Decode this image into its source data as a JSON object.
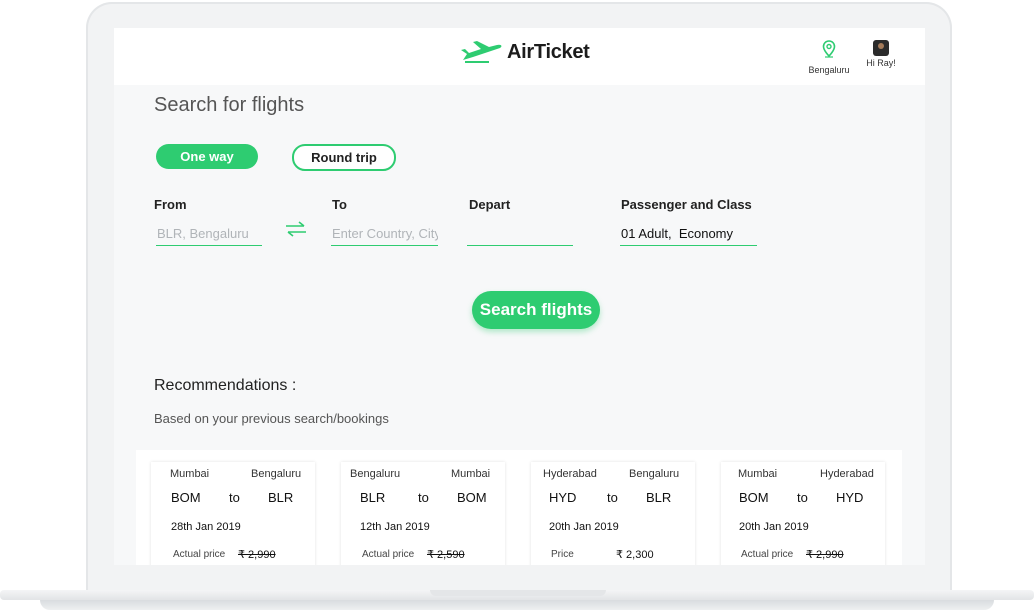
{
  "brand": {
    "name": "AirTicket",
    "accent_color": "#2ecc71",
    "logo_icon": "airplane-icon"
  },
  "nav": {
    "location_label": "Bengaluru",
    "location_icon": "location-pin-icon",
    "user_label": "Hi Ray!"
  },
  "search": {
    "title": "Search for flights",
    "trip_types": [
      "One way",
      "Round trip"
    ],
    "selected_trip": "One way",
    "from_label": "From",
    "from_placeholder": "BLR, Bengaluru",
    "to_label": "To",
    "to_placeholder": "Enter Country, City",
    "depart_label": "Depart",
    "depart_value": "",
    "passenger_label": "Passenger and Class",
    "passenger_value": "01 Adult,  Economy",
    "submit_label": "Search flights"
  },
  "recommendations": {
    "title": "Recommendations :",
    "subtitle": "Based on your previous search/bookings",
    "cards": [
      {
        "from_city": "Mumbai",
        "to_city": "Bengaluru",
        "from_code": "BOM",
        "sep": "to",
        "to_code": "BLR",
        "date": "28th Jan 2019",
        "price_label": "Actual price",
        "price": "₹ 2,990",
        "struck": true
      },
      {
        "from_city": "Bengaluru",
        "to_city": "Mumbai",
        "from_code": "BLR",
        "sep": "to",
        "to_code": "BOM",
        "date": "12th Jan 2019",
        "price_label": "Actual price",
        "price": "₹ 2,590",
        "struck": true
      },
      {
        "from_city": "Hyderabad",
        "to_city": "Bengaluru",
        "from_code": "HYD",
        "sep": "to",
        "to_code": "BLR",
        "date": "20th Jan 2019",
        "price_label": "Price",
        "price": "₹ 2,300",
        "struck": false
      },
      {
        "from_city": "Mumbai",
        "to_city": "Hyderabad",
        "from_code": "BOM",
        "sep": "to",
        "to_code": "HYD",
        "date": "20th Jan 2019",
        "price_label": "Actual price",
        "price": "₹ 2,990",
        "struck": true
      }
    ]
  }
}
